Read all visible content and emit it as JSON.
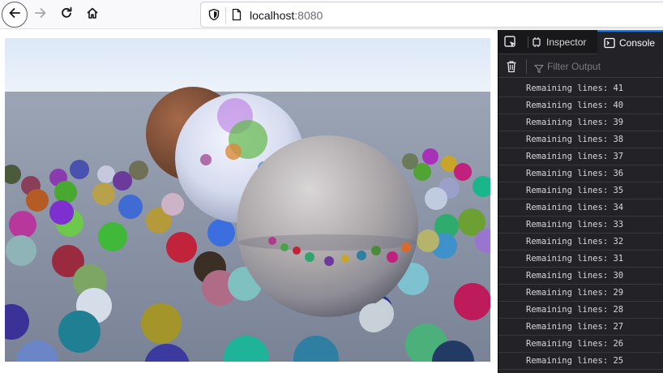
{
  "browser": {
    "url_host": "localhost",
    "url_port": ":8080",
    "icons": [
      "back-icon",
      "forward-icon",
      "reload-icon",
      "home-icon",
      "shield-icon",
      "page-icon"
    ]
  },
  "devtools": {
    "tabs": [
      {
        "label": "Inspector",
        "icon": "inspector-icon"
      },
      {
        "label": "Console",
        "icon": "console-icon",
        "active": true
      }
    ],
    "filter_placeholder": "Filter Output",
    "accent_color": "#0a84ff",
    "console_lines": [
      "Remaining lines: 41",
      "Remaining lines: 40",
      "Remaining lines: 39",
      "Remaining lines: 38",
      "Remaining lines: 37",
      "Remaining lines: 36",
      "Remaining lines: 35",
      "Remaining lines: 34",
      "Remaining lines: 33",
      "Remaining lines: 32",
      "Remaining lines: 31",
      "Remaining lines: 30",
      "Remaining lines: 29",
      "Remaining lines: 28",
      "Remaining lines: 27",
      "Remaining lines: 26",
      "Remaining lines: 25"
    ]
  },
  "render_image": {
    "subject": "ray-traced scene of many small colored spheres with large glass, brown and metal spheres"
  }
}
